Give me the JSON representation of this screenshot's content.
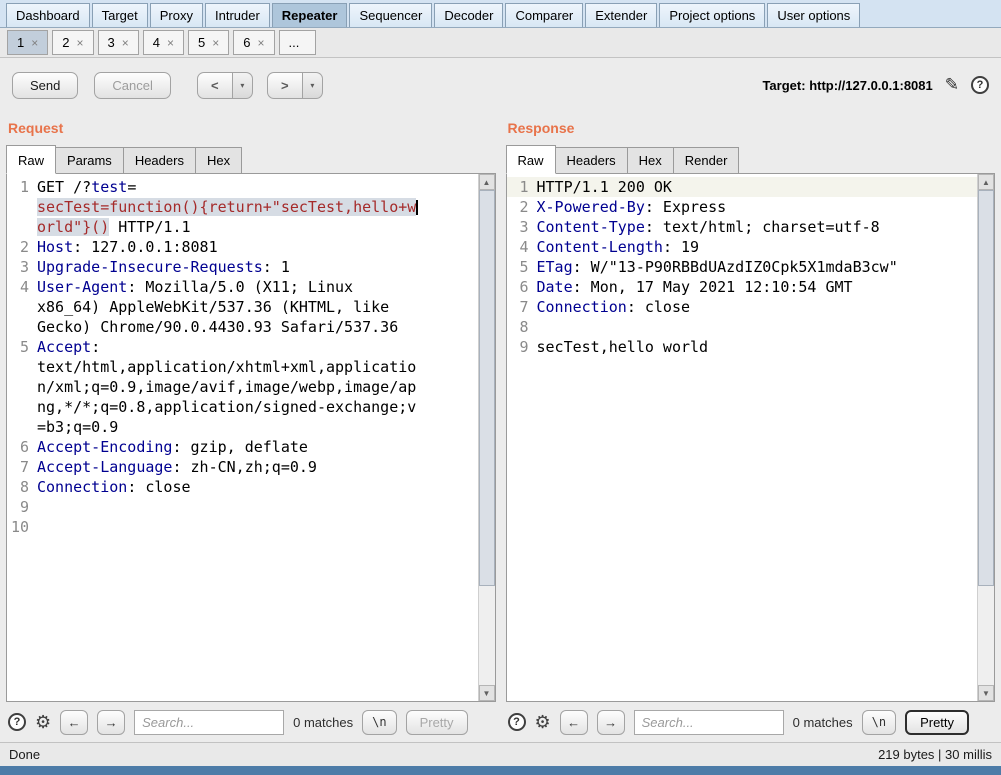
{
  "colors": {
    "accent_orange": "#e8734a",
    "header_key_navy": "#000090",
    "highlight_red": "#a52a2a",
    "selection_bg": "#d6dce4",
    "tab_bar_blue": "#d4e3f2"
  },
  "icons": {
    "pencil": "✎",
    "help": "?",
    "gear": "⚙",
    "prev": "←",
    "next": "→",
    "scroll_up": "▲",
    "scroll_down": "▼",
    "dropdown": "▾"
  },
  "main_tabs": {
    "items": [
      {
        "label": "Dashboard"
      },
      {
        "label": "Target"
      },
      {
        "label": "Proxy"
      },
      {
        "label": "Intruder"
      },
      {
        "label": "Repeater",
        "selected": true
      },
      {
        "label": "Sequencer"
      },
      {
        "label": "Decoder"
      },
      {
        "label": "Comparer"
      },
      {
        "label": "Extender"
      },
      {
        "label": "Project options"
      },
      {
        "label": "User options"
      }
    ]
  },
  "repeater_tabs": {
    "items": [
      {
        "label": "1",
        "close": "×",
        "selected": true
      },
      {
        "label": "2",
        "close": "×"
      },
      {
        "label": "3",
        "close": "×"
      },
      {
        "label": "4",
        "close": "×"
      },
      {
        "label": "5",
        "close": "×"
      },
      {
        "label": "6",
        "close": "×"
      },
      {
        "label": "...",
        "close": ""
      }
    ]
  },
  "toolbar": {
    "send": "Send",
    "cancel": "Cancel",
    "back": "<",
    "forward": ">",
    "target_label": "Target:",
    "target_url": "http://127.0.0.1:8081"
  },
  "request": {
    "title": "Request",
    "tabs": [
      {
        "label": "Raw",
        "selected": true
      },
      {
        "label": "Params"
      },
      {
        "label": "Headers"
      },
      {
        "label": "Hex"
      }
    ],
    "lines": [
      {
        "n": "1",
        "segs": [
          {
            "t": "GET /?",
            "c": "p"
          },
          {
            "t": "test",
            "c": "k"
          },
          {
            "t": "=",
            "c": "p"
          }
        ]
      },
      {
        "n": "",
        "segs": [
          {
            "t": "secTest=function(){return+\"secTest,hello+w",
            "c": "r"
          },
          {
            "t": "",
            "c": "cursor"
          }
        ]
      },
      {
        "n": "",
        "segs": [
          {
            "t": "orld\"}()",
            "c": "r"
          },
          {
            "t": " HTTP/1.1",
            "c": "p"
          }
        ]
      },
      {
        "n": "2",
        "segs": [
          {
            "t": "Host",
            "c": "k"
          },
          {
            "t": ": 127.0.0.1:8081",
            "c": "p"
          }
        ]
      },
      {
        "n": "3",
        "segs": [
          {
            "t": "Upgrade-Insecure-Requests",
            "c": "k"
          },
          {
            "t": ": 1",
            "c": "p"
          }
        ]
      },
      {
        "n": "4",
        "segs": [
          {
            "t": "User-Agent",
            "c": "k"
          },
          {
            "t": ": Mozilla/5.0 (X11; Linux",
            "c": "p"
          }
        ]
      },
      {
        "n": "",
        "segs": [
          {
            "t": "x86_64) AppleWebKit/537.36 (KHTML, like",
            "c": "p"
          }
        ]
      },
      {
        "n": "",
        "segs": [
          {
            "t": "Gecko) Chrome/90.0.4430.93 Safari/537.36",
            "c": "p"
          }
        ]
      },
      {
        "n": "5",
        "segs": [
          {
            "t": "Accept",
            "c": "k"
          },
          {
            "t": ":",
            "c": "p"
          }
        ]
      },
      {
        "n": "",
        "segs": [
          {
            "t": "text/html,application/xhtml+xml,applicatio",
            "c": "p"
          }
        ]
      },
      {
        "n": "",
        "segs": [
          {
            "t": "n/xml;q=0.9,image/avif,image/webp,image/ap",
            "c": "p"
          }
        ]
      },
      {
        "n": "",
        "segs": [
          {
            "t": "ng,*/*;q=0.8,application/signed-exchange;v",
            "c": "p"
          }
        ]
      },
      {
        "n": "",
        "segs": [
          {
            "t": "=b3;q=0.9",
            "c": "p"
          }
        ]
      },
      {
        "n": "6",
        "segs": [
          {
            "t": "Accept-Encoding",
            "c": "k"
          },
          {
            "t": ": gzip, deflate",
            "c": "p"
          }
        ]
      },
      {
        "n": "7",
        "segs": [
          {
            "t": "Accept-Language",
            "c": "k"
          },
          {
            "t": ": zh-CN,zh;q=0.9",
            "c": "p"
          }
        ]
      },
      {
        "n": "8",
        "segs": [
          {
            "t": "Connection",
            "c": "k"
          },
          {
            "t": ": close",
            "c": "p"
          }
        ]
      },
      {
        "n": "9",
        "segs": []
      },
      {
        "n": "10",
        "segs": []
      }
    ],
    "search": {
      "placeholder": "Search...",
      "matches": "0 matches",
      "newline": "\\n",
      "pretty": "Pretty"
    }
  },
  "response": {
    "title": "Response",
    "tabs": [
      {
        "label": "Raw",
        "selected": true
      },
      {
        "label": "Headers"
      },
      {
        "label": "Hex"
      },
      {
        "label": "Render"
      }
    ],
    "lines": [
      {
        "n": "1",
        "cur": true,
        "segs": [
          {
            "t": "HTTP/1.1 200 OK",
            "c": "p"
          }
        ]
      },
      {
        "n": "2",
        "segs": [
          {
            "t": "X-Powered-By",
            "c": "k"
          },
          {
            "t": ": Express",
            "c": "p"
          }
        ]
      },
      {
        "n": "3",
        "segs": [
          {
            "t": "Content-Type",
            "c": "k"
          },
          {
            "t": ": text/html; charset=utf-8",
            "c": "p"
          }
        ]
      },
      {
        "n": "4",
        "segs": [
          {
            "t": "Content-Length",
            "c": "k"
          },
          {
            "t": ": 19",
            "c": "p"
          }
        ]
      },
      {
        "n": "5",
        "segs": [
          {
            "t": "ETag",
            "c": "k"
          },
          {
            "t": ": W/\"13-P90RBBdUAzdIZ0Cpk5X1mdaB3cw\"",
            "c": "p"
          }
        ]
      },
      {
        "n": "6",
        "segs": [
          {
            "t": "Date",
            "c": "k"
          },
          {
            "t": ": Mon, 17 May 2021 12:10:54 GMT",
            "c": "p"
          }
        ]
      },
      {
        "n": "7",
        "segs": [
          {
            "t": "Connection",
            "c": "k"
          },
          {
            "t": ": close",
            "c": "p"
          }
        ]
      },
      {
        "n": "8",
        "segs": []
      },
      {
        "n": "9",
        "segs": [
          {
            "t": "secTest,hello world",
            "c": "p"
          }
        ]
      }
    ],
    "search": {
      "placeholder": "Search...",
      "matches": "0 matches",
      "newline": "\\n",
      "pretty": "Pretty"
    }
  },
  "statusbar": {
    "left": "Done",
    "right": "219 bytes | 30 millis"
  }
}
